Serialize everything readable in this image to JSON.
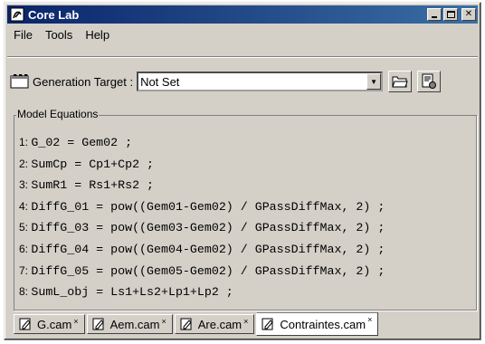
{
  "window": {
    "title": "Core Lab",
    "minimize_icon": "minimize-icon",
    "maximize_icon": "maximize-icon",
    "close_icon": "close-icon"
  },
  "menu": {
    "items": [
      "File",
      "Tools",
      "Help"
    ]
  },
  "toolbar": {
    "generation_label": "Generation Target :",
    "target_value": "Not Set",
    "open_icon": "folder-open-icon",
    "generate_icon": "generate-icon"
  },
  "equations": {
    "group_label": "Model Equations",
    "lines": [
      {
        "num": "1:",
        "code": "G_02 = Gem02 ;"
      },
      {
        "num": "2:",
        "code": "SumCp = Cp1+Cp2 ;"
      },
      {
        "num": "3:",
        "code": "SumR1 = Rs1+Rs2 ;"
      },
      {
        "num": "4:",
        "code": "DiffG_01 = pow((Gem01-Gem02) / GPassDiffMax, 2) ;"
      },
      {
        "num": "5:",
        "code": "DiffG_03 = pow((Gem03-Gem02) / GPassDiffMax, 2) ;"
      },
      {
        "num": "6:",
        "code": "DiffG_04 = pow((Gem04-Gem02) / GPassDiffMax, 2) ;"
      },
      {
        "num": "7:",
        "code": "DiffG_05 = pow((Gem05-Gem02) / GPassDiffMax, 2) ;"
      },
      {
        "num": "8:",
        "code": "SumL_obj = Ls1+Ls2+Lp1+Lp2 ;"
      }
    ]
  },
  "tabs": [
    {
      "label": "G.cam",
      "active": false
    },
    {
      "label": "Aem.cam",
      "active": false
    },
    {
      "label": "Are.cam",
      "active": false
    },
    {
      "label": "Contraintes.cam",
      "active": true
    }
  ],
  "close_mark": "×",
  "colors": {
    "titlebar_start": "#0a246a",
    "titlebar_end": "#3a6ea5",
    "face": "#d4d0c8"
  }
}
